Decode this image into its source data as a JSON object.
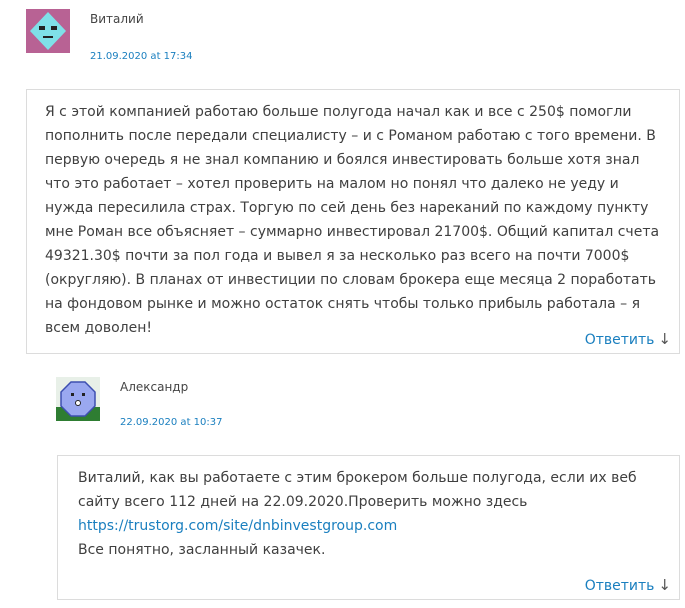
{
  "comments": [
    {
      "author": "Виталий",
      "date": "21.09.2020 at 17:34",
      "text": "Я с этой компанией работаю больше полугода начал как и все с 250$ помогли пополнить после передали специалисту – и с Романом работаю с того времени. В первую очередь я не знал компанию и боялся инвестировать больше хотя знал что это работает – хотел проверить на малом но понял что далеко не уеду и нужда пересилила страх. Торгую по сей день без нареканий по каждому пункту мне Роман все объясняет – суммарно инвестировал 21700$. Общий капитал счета 49321.30$ почти за пол года и вывел я за несколько раз всего на почти 7000$ (округляю). В планах от инвестиции по словам брокера еще месяца 2 поработать на фондовом рынке и можно остаток снять чтобы только прибыль работала – я всем доволен!",
      "reply_label": "Ответить",
      "reply_arrow": "↓"
    },
    {
      "author": "Александр",
      "date": "22.09.2020 at 10:37",
      "text_before_link": "Виталий, как вы работаете с этим брокером больше полугода, если их веб сайту всего 112 дней на 22.09.2020.Проверить можно здесь",
      "link": "https://trustorg.com/site/dnbinvestgroup.com",
      "text_after_link": "Все понятно, засланный казачек.",
      "reply_label": "Ответить",
      "reply_arrow": "↓"
    }
  ]
}
